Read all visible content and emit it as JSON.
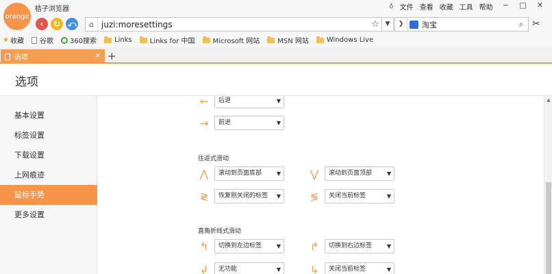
{
  "app": {
    "logo_text": "orange",
    "title": "桔子浏览器",
    "menus": [
      "文件",
      "查看",
      "收藏",
      "工具",
      "帮助"
    ],
    "window_controls": [
      "−",
      "□",
      "✕"
    ]
  },
  "toolbar": {
    "back_icon": "‹",
    "refresh_icon": "↻",
    "home_icon": "⤺",
    "url": "juzi:moresettings",
    "search_engine_text": "淘宝"
  },
  "bookmarks": {
    "favorites_label": "收藏",
    "items": [
      "谷歌",
      "360搜索",
      "Links",
      "Links for 中国",
      "Microsoft 网站",
      "MSN 网站",
      "Windows Live"
    ]
  },
  "tabs": [
    {
      "label": "选项"
    }
  ],
  "page": {
    "title": "选项",
    "sidebar": [
      {
        "label": "基本设置",
        "active": false
      },
      {
        "label": "标签设置",
        "active": false
      },
      {
        "label": "下载设置",
        "active": false
      },
      {
        "label": "上网痕迹",
        "active": false
      },
      {
        "label": "鼠标手势",
        "active": true
      },
      {
        "label": "更多设置",
        "active": false
      }
    ],
    "gestures_top": [
      {
        "icon": "←",
        "value": "后退"
      },
      {
        "icon": "→",
        "value": "前进"
      }
    ],
    "section_roundtrip": {
      "label": "往返式滑动",
      "items": [
        {
          "icon": "⋀",
          "value": "滚动到页面底部"
        },
        {
          "icon": "⋁",
          "value": "滚动到页面顶部"
        },
        {
          "icon": "≷",
          "value": "恢复刚关闭的标签"
        },
        {
          "icon": "≶",
          "value": "关闭当前标签"
        }
      ]
    },
    "section_rightangle": {
      "label": "直角折线式滑动",
      "items": [
        {
          "icon": "↰",
          "value": "切换到左边标签"
        },
        {
          "icon": "↱",
          "value": "切换到右边标签"
        },
        {
          "icon": "↲",
          "value": "无功能"
        },
        {
          "icon": "↳",
          "value": "关闭当前标签"
        }
      ]
    }
  },
  "colors": {
    "accent": "#f7944a"
  }
}
